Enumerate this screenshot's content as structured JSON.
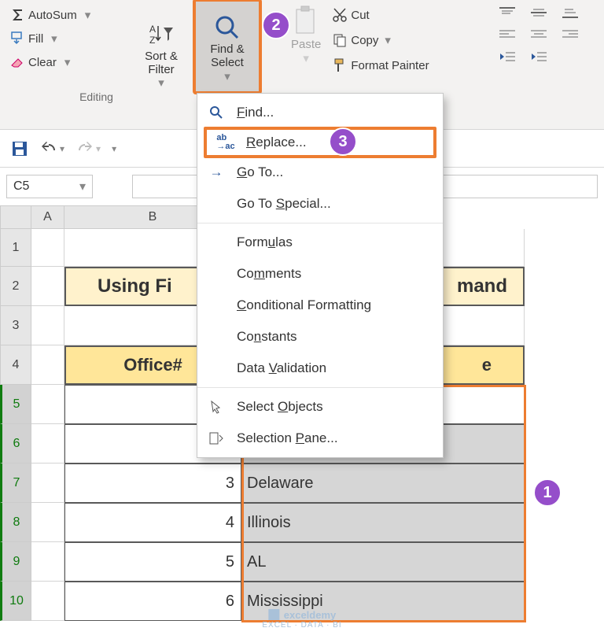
{
  "ribbon": {
    "autosum": "AutoSum",
    "fill": "Fill",
    "clear": "Clear",
    "sort": "Sort &\nFilter",
    "find": "Find &\nSelect",
    "paste": "Paste",
    "cut": "Cut",
    "copy": "Copy",
    "format_painter": "Format Painter",
    "editing_label": "Editing"
  },
  "namebox": "C5",
  "columns": {
    "A": "A",
    "B": "B"
  },
  "rows": [
    "1",
    "2",
    "3",
    "4",
    "5",
    "6",
    "7",
    "8",
    "9",
    "10"
  ],
  "table": {
    "title": "Using Fi",
    "title_suffix": "mand",
    "header_b": "Office#",
    "header_c_suffix": "e",
    "data": [
      {
        "num": "3",
        "state": "Delaware"
      },
      {
        "num": "4",
        "state": "Illinois"
      },
      {
        "num": "5",
        "state": "AL"
      },
      {
        "num": "6",
        "state": "Mississippi"
      }
    ]
  },
  "dropdown": {
    "find": "Find...",
    "replace": "Replace...",
    "goto": "Go To...",
    "goto_special": "Go To Special...",
    "formulas": "Formulas",
    "comments": "Comments",
    "cond_format": "Conditional Formatting",
    "constants": "Constants",
    "data_validation": "Data Validation",
    "select_objects": "Select Objects",
    "selection_pane": "Selection Pane..."
  },
  "badges": {
    "b1": "1",
    "b2": "2",
    "b3": "3"
  },
  "watermark": {
    "name": "exceldemy",
    "sub": "EXCEL · DATA · BI"
  }
}
